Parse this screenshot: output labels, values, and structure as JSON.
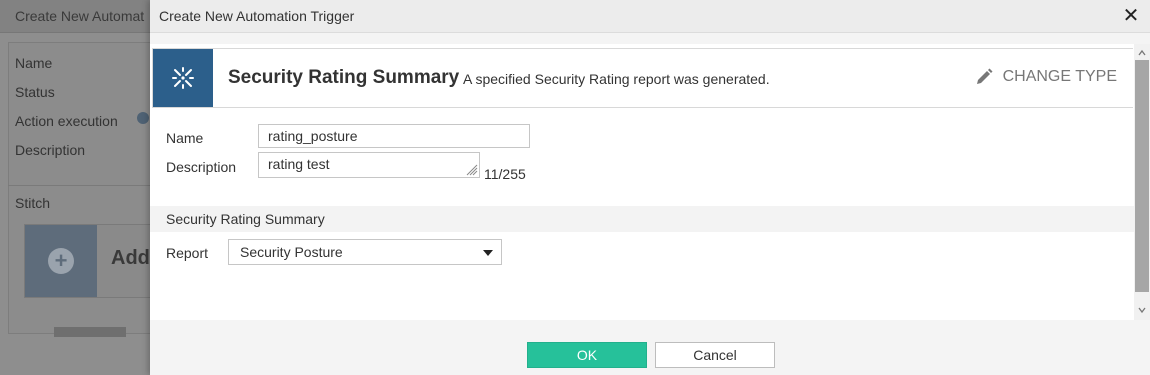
{
  "background": {
    "title": "Create New Automat",
    "fields": [
      "Name",
      "Status",
      "Action execution",
      "Description"
    ],
    "section": "Stitch",
    "add_label": "Add"
  },
  "modal": {
    "title": "Create New Automation Trigger",
    "close_icon": "close-icon",
    "trigger_type": {
      "name": "Security Rating Summary",
      "description": "A specified Security Rating report was generated.",
      "change_label": "CHANGE TYPE",
      "icon": "security-rating-icon",
      "icon_bg": "#2c5f8b"
    },
    "form": {
      "name_label": "Name",
      "name_value": "rating_posture",
      "description_label": "Description",
      "description_value": "rating test",
      "char_count": "11/255"
    },
    "section": {
      "title": "Security Rating Summary",
      "report_label": "Report",
      "report_value": "Security Posture"
    },
    "buttons": {
      "ok": "OK",
      "cancel": "Cancel",
      "ok_color": "#26c19a"
    }
  }
}
